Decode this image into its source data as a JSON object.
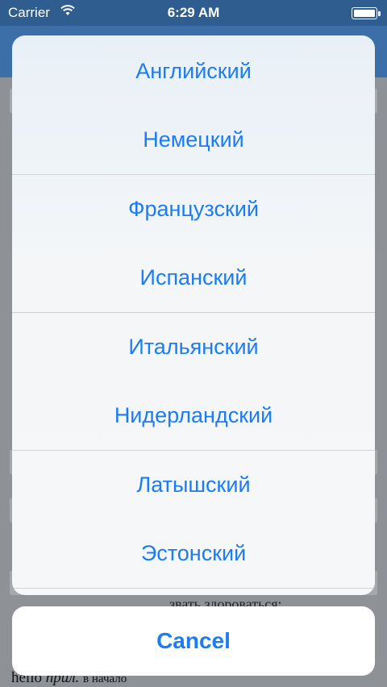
{
  "status_bar": {
    "carrier": "Carrier",
    "wifi_icon": "wifi-icon",
    "time": "6:29 AM",
    "battery_icon": "battery-icon"
  },
  "background": {
    "partial_text": "звать здороваться;",
    "bottom_row": {
      "word": "hello",
      "pos": "прил.",
      "note": "в начало"
    }
  },
  "action_sheet": {
    "items": [
      "Английский",
      "Немецкий",
      "Французский",
      "Испанский",
      "Итальянский",
      "Нидерландский",
      "Латышский",
      "Эстонский"
    ],
    "cancel_label": "Cancel"
  },
  "colors": {
    "accent": "#1b7cf4",
    "nav": "#3c6ea8"
  }
}
